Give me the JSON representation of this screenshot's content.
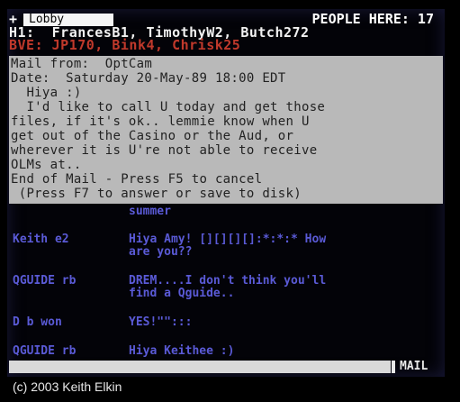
{
  "header": {
    "plus": "+",
    "room_tab": "Lobby",
    "people_here": "PEOPLE HERE: 17"
  },
  "roster": {
    "line1": "H1:  FrancesB1, TimothyW2, Butch272",
    "line2": "BVE: JP170, Bink4, Chrisk25"
  },
  "mail": {
    "lines": [
      "Mail from:  OptCam",
      "Date:  Saturday 20-May-89 18:00 EDT",
      "  Hiya :)",
      "  I'd like to call U today and get those",
      "files, if it's ok.. lemmie know when U",
      "get out of the Casino or the Aud, or",
      "wherever it is U're not able to receive",
      "OLMs at..",
      "End of Mail - Press F5 to cancel",
      " (Press F7 to answer or save to disk)"
    ]
  },
  "chat": {
    "fragment": "summer",
    "messages": [
      {
        "handle": "Keith e2",
        "line1": "Hiya Amy! [][][][]:*:*:* How",
        "line2": "are you??"
      },
      {
        "handle": "QGUIDE rb",
        "line1": "DREM....I don't think you'll",
        "line2": "find a Qguide.."
      },
      {
        "handle": "D b won",
        "line1": "YES!\"\":::",
        "line2": ""
      },
      {
        "handle": "QGUIDE rb",
        "line1": "Hiya Keithee :)",
        "line2": ""
      }
    ]
  },
  "input": {
    "value": "",
    "mode": "MAIL"
  },
  "caption": "(c) 2003 Keith Elkin"
}
